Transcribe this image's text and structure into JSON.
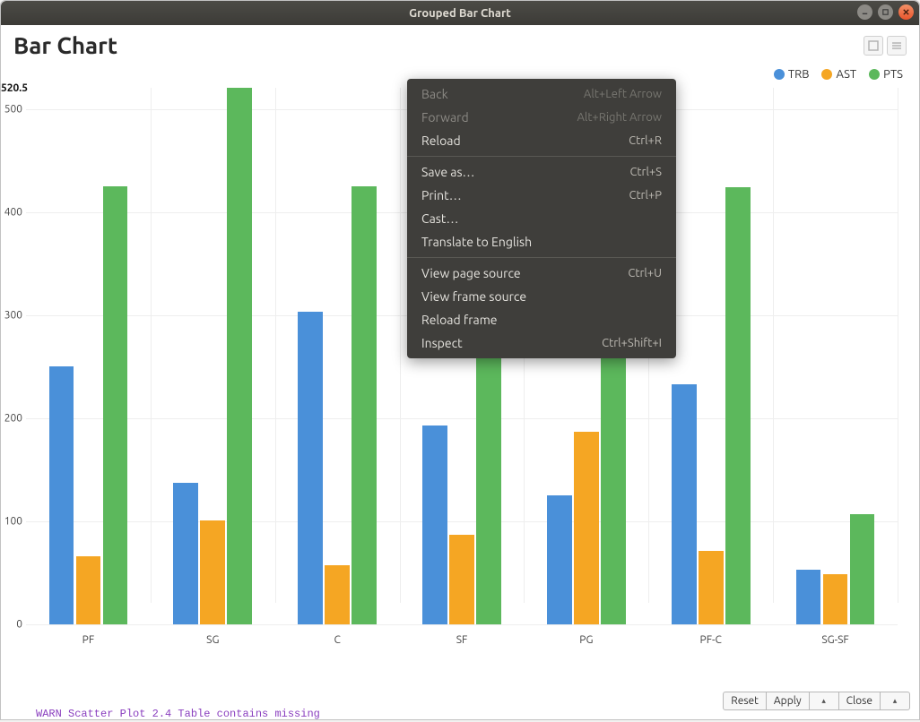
{
  "window": {
    "title": "Grouped Bar Chart"
  },
  "chart": {
    "title": "Bar Chart"
  },
  "legend": [
    {
      "name": "TRB",
      "color": "#4a90d9"
    },
    {
      "name": "AST",
      "color": "#f5a623"
    },
    {
      "name": "PTS",
      "color": "#5cb85c"
    }
  ],
  "y_ticks": [
    0,
    100,
    200,
    300,
    400,
    500
  ],
  "peak_label": "520.5",
  "chart_data": {
    "type": "bar",
    "title": "Bar Chart",
    "xlabel": "",
    "ylabel": "",
    "ylim": [
      0,
      520.5
    ],
    "categories": [
      "PF",
      "SG",
      "C",
      "SF",
      "PG",
      "PF-C",
      "SG-SF"
    ],
    "series": [
      {
        "name": "TRB",
        "color": "#4a90d9",
        "values": [
          250,
          137,
          303,
          193,
          125,
          233,
          53
        ]
      },
      {
        "name": "AST",
        "color": "#f5a623",
        "values": [
          66,
          101,
          57,
          87,
          187,
          71,
          49
        ]
      },
      {
        "name": "PTS",
        "color": "#5cb85c",
        "values": [
          425,
          520.5,
          425,
          435,
          445,
          424,
          107
        ]
      }
    ]
  },
  "context_menu": {
    "rows": [
      {
        "label": "Back",
        "accel": "Alt+Left Arrow",
        "enabled": false
      },
      {
        "label": "Forward",
        "accel": "Alt+Right Arrow",
        "enabled": false
      },
      {
        "label": "Reload",
        "accel": "Ctrl+R",
        "enabled": true
      },
      {
        "sep": true
      },
      {
        "label": "Save as…",
        "accel": "Ctrl+S",
        "enabled": true
      },
      {
        "label": "Print…",
        "accel": "Ctrl+P",
        "enabled": true
      },
      {
        "label": "Cast…",
        "accel": "",
        "enabled": true
      },
      {
        "label": "Translate to English",
        "accel": "",
        "enabled": true
      },
      {
        "sep": true
      },
      {
        "label": "View page source",
        "accel": "Ctrl+U",
        "enabled": true
      },
      {
        "label": "View frame source",
        "accel": "",
        "enabled": true
      },
      {
        "label": "Reload frame",
        "accel": "",
        "enabled": true
      },
      {
        "label": "Inspect",
        "accel": "Ctrl+Shift+I",
        "enabled": true
      }
    ]
  },
  "footer": {
    "reset": "Reset",
    "apply": "Apply",
    "close": "Close"
  },
  "warn_text": " WARN  Scatter Plot         2.4        Table contains missing"
}
